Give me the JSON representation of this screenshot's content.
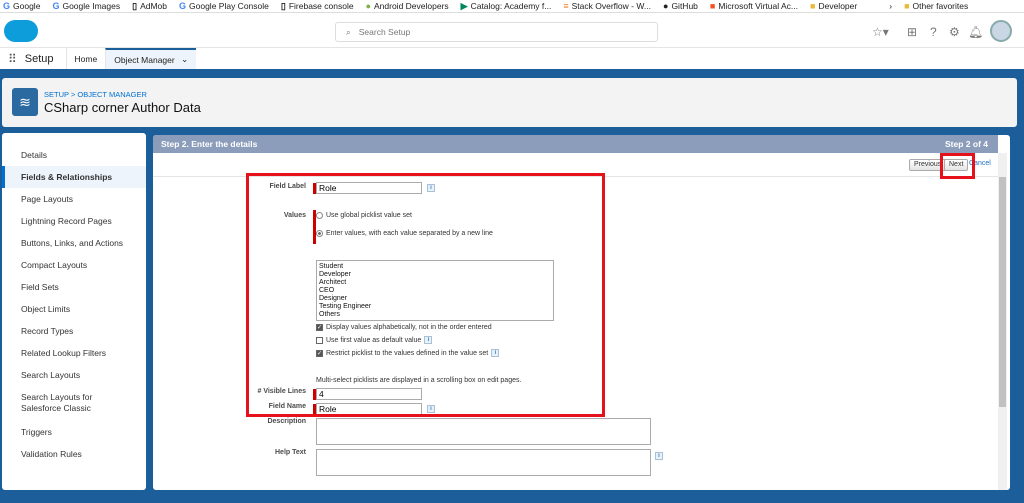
{
  "bookmarks": [
    "Google",
    "Google Images",
    "AdMob",
    "Google Play Console",
    "Firebase console",
    "Android Developers",
    "Catalog: Academy f...",
    "Stack Overflow - W...",
    "GitHub",
    "Microsoft Virtual Ac...",
    "Developer",
    "Other favorites"
  ],
  "header": {
    "search_placeholder": "Search Setup"
  },
  "nav": {
    "app": "Setup",
    "tabs": [
      "Home",
      "Object Manager"
    ]
  },
  "object": {
    "breadcrumb": "SETUP > OBJECT MANAGER",
    "title": "CSharp corner Author Data"
  },
  "sidebar": {
    "items": [
      "Details",
      "Fields & Relationships",
      "Page Layouts",
      "Lightning Record Pages",
      "Buttons, Links, and Actions",
      "Compact Layouts",
      "Field Sets",
      "Object Limits",
      "Record Types",
      "Related Lookup Filters",
      "Search Layouts",
      "Search Layouts for Salesforce Classic",
      "Triggers",
      "Validation Rules"
    ],
    "active": 1
  },
  "step": {
    "title": "Step 2. Enter the details",
    "progress": "Step 2 of 4",
    "previous": "Previous",
    "next": "Next",
    "cancel": "Cancel"
  },
  "form": {
    "field_label": {
      "label": "Field Label",
      "value": "Role"
    },
    "values": {
      "label": "Values",
      "opt_global": "Use global picklist value set",
      "opt_enter": "Enter values, with each value separated by a new line",
      "list": "Student\nDeveloper\nArchitect\nCEO\nDesigner\nTesting Engineer\nOthers"
    },
    "cb_alpha": "Display values alphabetically, not in the order entered",
    "cb_default": "Use first value as default value",
    "cb_restrict": "Restrict picklist to the values defined in the value set",
    "multiselect_note": "Multi-select picklists are displayed in a scrolling box on edit pages.",
    "visible_lines": {
      "label": "# Visible Lines",
      "value": "4"
    },
    "field_name": {
      "label": "Field Name",
      "value": "Role"
    },
    "description": {
      "label": "Description"
    },
    "help_text": {
      "label": "Help Text"
    }
  },
  "colors": {
    "brand": "#0d9dda",
    "background": "#1b5e99",
    "annotation": "#e5121c",
    "step_bar": "#8c9dbb"
  }
}
